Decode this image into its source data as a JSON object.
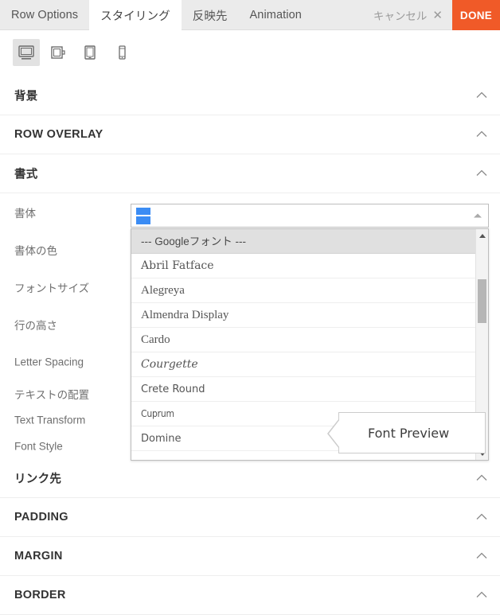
{
  "topbar": {
    "tabs": [
      {
        "label": "Row Options",
        "active": false
      },
      {
        "label": "スタイリング",
        "active": true
      },
      {
        "label": "反映先",
        "active": false
      },
      {
        "label": "Animation",
        "active": false
      }
    ],
    "cancel_label": "キャンセル",
    "cancel_icon": "close-icon",
    "close_glyph": "✕",
    "done_label": "DONE",
    "done_color": "#f05a28"
  },
  "devices": [
    {
      "name": "desktop",
      "icon": "desktop-icon",
      "active": true
    },
    {
      "name": "laptop",
      "icon": "laptop-icon",
      "active": false
    },
    {
      "name": "tablet",
      "icon": "tablet-icon",
      "active": false
    },
    {
      "name": "mobile",
      "icon": "mobile-icon",
      "active": false
    }
  ],
  "sections": {
    "background": "背景",
    "row_overlay": "ROW OVERLAY",
    "typography": "書式",
    "link": "リンク先",
    "padding": "PADDING",
    "margin": "MARGIN",
    "border": "BORDER"
  },
  "fields": {
    "font_family": "書体",
    "font_color": "書体の色",
    "font_size": "フォントサイズ",
    "line_height": "行の高さ",
    "letter_spacing": "Letter Spacing",
    "text_align": "テキストの配置",
    "text_transform": "Text Transform",
    "font_style": "Font Style"
  },
  "font_select": {
    "value": "",
    "state": "open",
    "caret_icon": "chevron-up-icon",
    "selection_highlight_color": "#3b8cf4",
    "options": [
      {
        "label": "--- Googleフォント ---",
        "group": true,
        "style": "f-sans"
      },
      {
        "label": "Abril Fatface",
        "group": false,
        "style": "f-display"
      },
      {
        "label": "Alegreya",
        "group": false,
        "style": "f-serif"
      },
      {
        "label": "Almendra Display",
        "group": false,
        "style": "f-serif"
      },
      {
        "label": "Cardo",
        "group": false,
        "style": "f-serif"
      },
      {
        "label": "Courgette",
        "group": false,
        "style": "f-script"
      },
      {
        "label": "Crete Round",
        "group": false,
        "style": "f-dvsans"
      },
      {
        "label": "Cuprum",
        "group": false,
        "style": "f-cond"
      },
      {
        "label": "Domine",
        "group": false,
        "style": "f-dvsans"
      }
    ],
    "scrollbar": {
      "up_icon": "scroll-up-arrow-icon",
      "down_icon": "scroll-down-arrow-icon"
    }
  },
  "preview_tooltip": {
    "text": "Font Preview"
  }
}
